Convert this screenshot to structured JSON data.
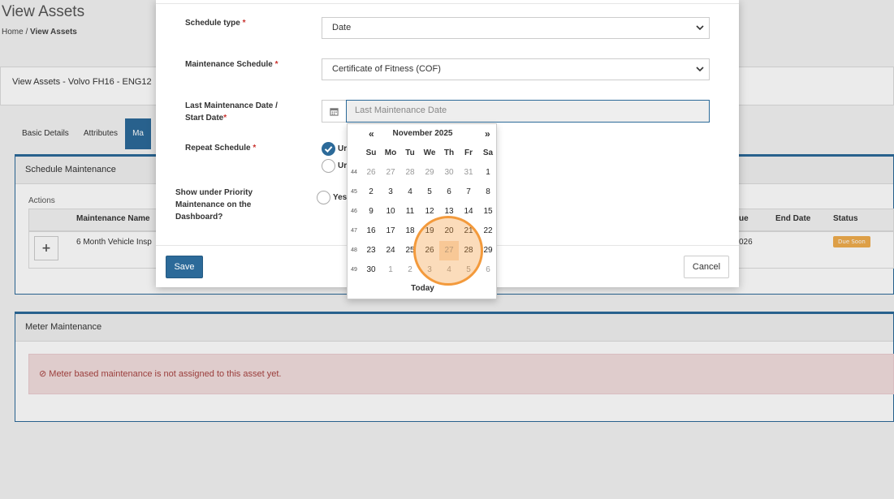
{
  "page": {
    "title": "View Assets",
    "breadcrumb_home": "Home",
    "breadcrumb_sep": "/",
    "breadcrumb_current": "View Assets",
    "card_title": "View Assets - Volvo FH16 - ENG12",
    "tabs": [
      "Basic Details",
      "Attributes",
      "Ma"
    ],
    "schedule_section": "Schedule Maintenance",
    "actions_label": "Actions",
    "col_name": "Maintenance Name",
    "col_due": "ue",
    "col_end": "End Date",
    "col_status": "Status",
    "row_name": "6 Month Vehicle Insp",
    "row_due": "026",
    "row_status": "Due Soon",
    "add_symbol": "+",
    "meter_section": "Meter Maintenance",
    "meter_alert": "Meter based maintenance is not assigned to this asset yet.",
    "alert_icon": "⊘"
  },
  "modal": {
    "schedule_type_label": "Schedule type",
    "schedule_type_value": "Date",
    "maint_schedule_label": "Maintenance Schedule",
    "maint_schedule_value": "Certificate of Fitness (COF)",
    "last_date_label_1": "Last Maintenance Date /",
    "last_date_label_2": "Start Date",
    "last_date_placeholder": "Last Maintenance Date",
    "repeat_label": "Repeat Schedule",
    "repeat_opt1": "Ur",
    "repeat_opt2": "Ur",
    "priority_label_1": "Show under Priority",
    "priority_label_2": "Maintenance on the",
    "priority_label_3": "Dashboard?",
    "priority_yes": "Yes",
    "required_mark": "*",
    "save_label": "Save",
    "cancel_label": "Cancel"
  },
  "datepicker": {
    "prev": "«",
    "next": "»",
    "title": "November 2025",
    "dow": [
      "Su",
      "Mo",
      "Tu",
      "We",
      "Th",
      "Fr",
      "Sa"
    ],
    "weeks": [
      {
        "wk": "44",
        "days": [
          "26",
          "27",
          "28",
          "29",
          "30",
          "31",
          "1"
        ]
      },
      {
        "wk": "45",
        "days": [
          "2",
          "3",
          "4",
          "5",
          "6",
          "7",
          "8"
        ]
      },
      {
        "wk": "46",
        "days": [
          "9",
          "10",
          "11",
          "12",
          "13",
          "14",
          "15"
        ]
      },
      {
        "wk": "47",
        "days": [
          "16",
          "17",
          "18",
          "19",
          "20",
          "21",
          "22"
        ]
      },
      {
        "wk": "48",
        "days": [
          "23",
          "24",
          "25",
          "26",
          "27",
          "28",
          "29"
        ]
      },
      {
        "wk": "49",
        "days": [
          "30",
          "1",
          "2",
          "3",
          "4",
          "5",
          "6"
        ]
      }
    ],
    "today_label": "Today"
  },
  "colors": {
    "primary": "#2c6a99",
    "highlight_ring": "#f39a3c",
    "badge": "#f0ad4e",
    "alert_bg": "#f2dede"
  }
}
